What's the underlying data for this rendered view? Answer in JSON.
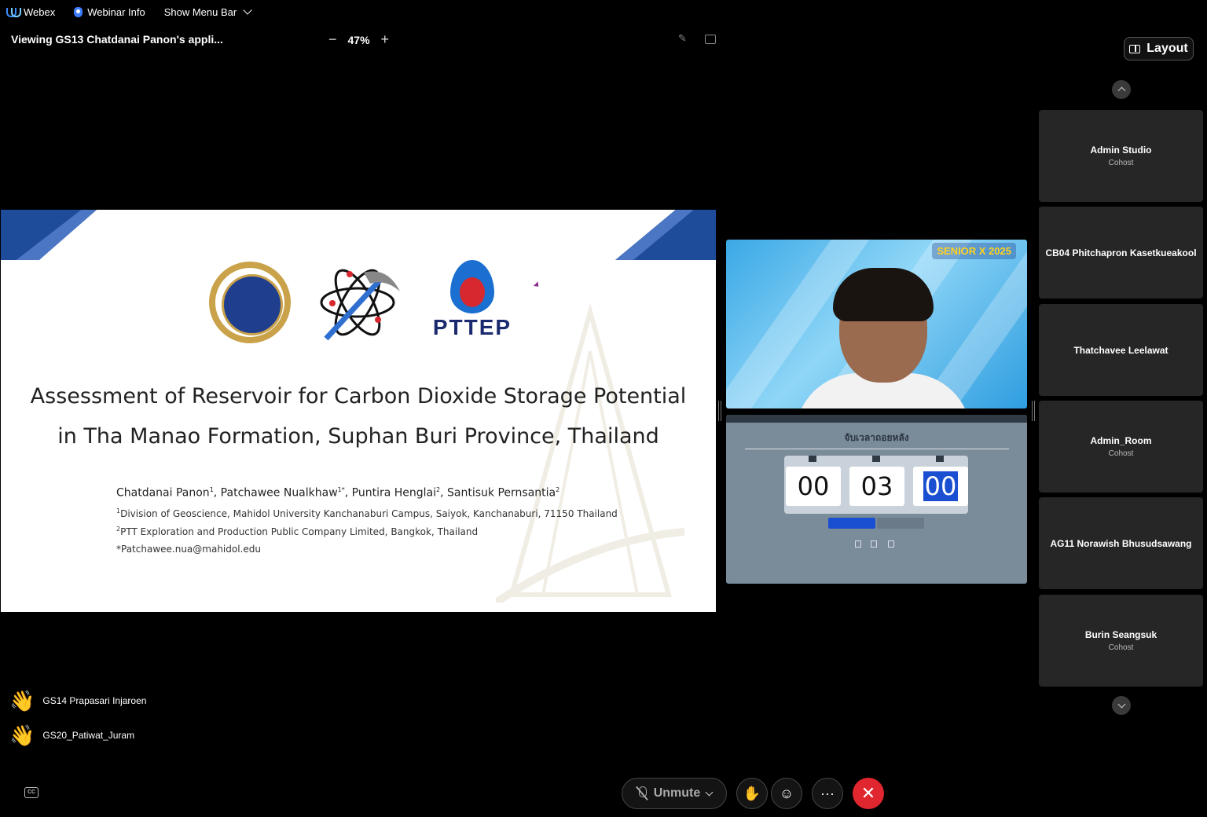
{
  "menubar": {
    "app_name": "Webex",
    "webinar_info": "Webinar Info",
    "show_menu_bar": "Show Menu Bar"
  },
  "share": {
    "title": "Viewing GS13 Chatdanai Panon's appli...",
    "zoom": "47%",
    "zoom_out": "−",
    "zoom_in": "+"
  },
  "slide": {
    "logo_text": "PTTEP",
    "title_line1": "Assessment of Reservoir for Carbon Dioxide Storage Potential",
    "title_line2": "in Tha Manao Formation, Suphan Buri Province, Thailand",
    "author1": "Chatdanai Panon",
    "author1_sup": "1",
    "author2": ", Patchawee Nualkhaw",
    "author2_sup": "1*",
    "author3": ", Puntira Henglai",
    "author3_sup": "2",
    "author4": ", Santisuk Pernsantia",
    "author4_sup": "2",
    "affil1_sup": "1",
    "affil1": "Division of Geoscience, Mahidol University Kanchanaburi Campus, Saiyok, Kanchanaburi, 71150 Thailand",
    "affil2_sup": "2",
    "affil2": "PTT Exploration and Production Public Company Limited, Bangkok, Thailand",
    "email": "*Patchawee.nua@mahidol.edu"
  },
  "video": {
    "banner": "SENIOR X 2025"
  },
  "timer": {
    "heading": "จับเวลาถอยหลัง",
    "hours": "00",
    "minutes": "03",
    "seconds": "00"
  },
  "layout_label": "Layout",
  "participants": [
    {
      "name": "Admin Studio",
      "role": "Cohost"
    },
    {
      "name": "CB04 Phitchapron Kasetkueakool",
      "role": ""
    },
    {
      "name": "Thatchavee Leelawat",
      "role": ""
    },
    {
      "name": "Admin_Room",
      "role": "Cohost"
    },
    {
      "name": "AG11 Norawish Bhusudsawang",
      "role": ""
    },
    {
      "name": "Burin Seangsuk",
      "role": "Cohost"
    }
  ],
  "raised_hands": [
    {
      "name": "GS14 Prapasari Injaroen"
    },
    {
      "name": "GS20_Patiwat_Juram"
    }
  ],
  "controls": {
    "unmute": "Unmute",
    "more": "···",
    "end": "✕"
  },
  "colors": {
    "slide_blue": "#1e4b9a",
    "end_call_red": "#e0262e",
    "tile_bg": "#262626"
  }
}
